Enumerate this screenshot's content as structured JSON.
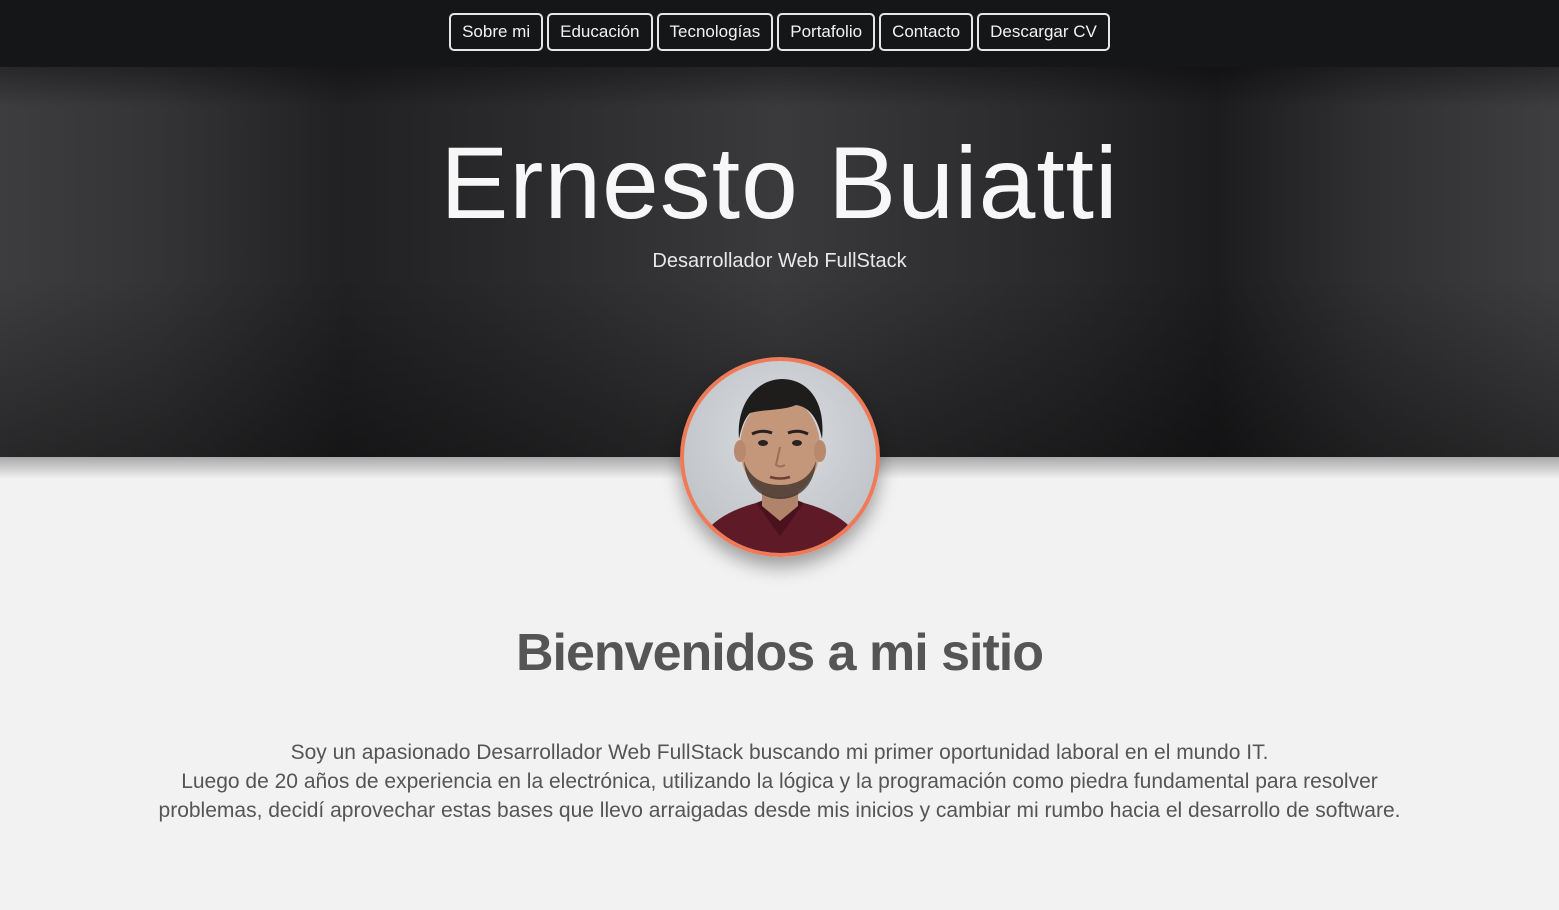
{
  "nav": {
    "items": [
      {
        "label": "Sobre mi"
      },
      {
        "label": "Educación"
      },
      {
        "label": "Tecnologías"
      },
      {
        "label": "Portafolio"
      },
      {
        "label": "Contacto"
      },
      {
        "label": "Descargar CV"
      }
    ]
  },
  "hero": {
    "title": "Ernesto Buiatti",
    "subtitle": "Desarrollador Web FullStack"
  },
  "avatar": {
    "border_color": "#ef7a57"
  },
  "welcome": {
    "title": "Bienvenidos a mi sitio",
    "bio_line1": "Soy un apasionado Desarrollador Web FullStack buscando mi primer oportunidad laboral en el mundo IT.",
    "bio_line2": "Luego de 20 años de experiencia en la electrónica, utilizando la lógica y la programación como piedra fundamental para resolver problemas, decidí aprovechar estas bases que llevo arraigadas desde mis inicios y cambiar mi rumbo hacia el desarrollo de software."
  }
}
